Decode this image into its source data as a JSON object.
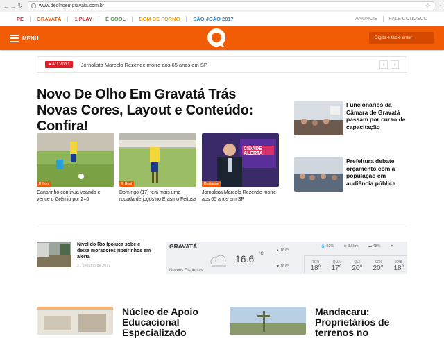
{
  "browser": {
    "url": "www.deolhoemgravata.com.br"
  },
  "topnav": {
    "items": [
      {
        "label": "PE",
        "color": "#e41e26"
      },
      {
        "label": "GRAVATÁ",
        "color": "#f25c05"
      },
      {
        "label": "1 PLAY",
        "color": "#e41e26"
      },
      {
        "label": "É GOOL",
        "color": "#3aa935"
      },
      {
        "label": "BOM DE FORNO",
        "color": "#f2a100"
      },
      {
        "label": "SÃO JOÃO 2017",
        "color": "#1e88d8"
      }
    ],
    "right": [
      "ANUNCIE",
      "FALE CONOSCO"
    ]
  },
  "header": {
    "menu_label": "MENU",
    "search_placeholder": "Digite e tecle enter",
    "accent": "#f25c05"
  },
  "ticker": {
    "badge": "AO VIVO",
    "text": "Jornalista Marcelo Rezende morre aos 65 anos em SP"
  },
  "main": {
    "headline": "Novo De Olho Em Gravatá Trás Novas Cores, Layout e Conteúdo: Confira!",
    "cards": [
      {
        "tag": "É Gool",
        "caption": "Canarinho continua voando e vence o Grêmio por 2×0"
      },
      {
        "tag": "É Gool",
        "caption": "Domingo (17) tem mais uma rodada de jogos no Erasmo Feitosa"
      },
      {
        "tag": "Destaque",
        "caption": "Jornalista Marcelo Rezende morre aos 65 anos em SP"
      }
    ],
    "tv_text": "CIDADE ALERTA"
  },
  "side_news": [
    {
      "title": "Funcionários da Câmara de Gravatá passam por curso de capacitação"
    },
    {
      "title": "Prefeitura debate orçamento com a população em audiência pública"
    }
  ],
  "small_news": {
    "title": "Nível do Rio Ipojuca sobe e deixa moradores ribeirinhos em alerta",
    "date": "21 de julho de 2017"
  },
  "weather": {
    "city": "GRAVATÁ",
    "condition": "Nuvens Dispersas",
    "temp": "16.6",
    "unit": "°C",
    "max": "16.6°",
    "min": "16.6°",
    "humidity": "92%",
    "wind": "3.5km",
    "clouds": "48%",
    "days": [
      {
        "name": "TER",
        "temp": "18°"
      },
      {
        "name": "QUA",
        "temp": "17°"
      },
      {
        "name": "QUI",
        "temp": "20°"
      },
      {
        "name": "SEX",
        "temp": "20°"
      },
      {
        "name": "SÁB",
        "temp": "18°"
      }
    ]
  },
  "features": [
    {
      "title": "Núcleo de Apoio Educacional Especializado"
    },
    {
      "title": "Mandacaru: Proprietários de terrenos no"
    }
  ]
}
